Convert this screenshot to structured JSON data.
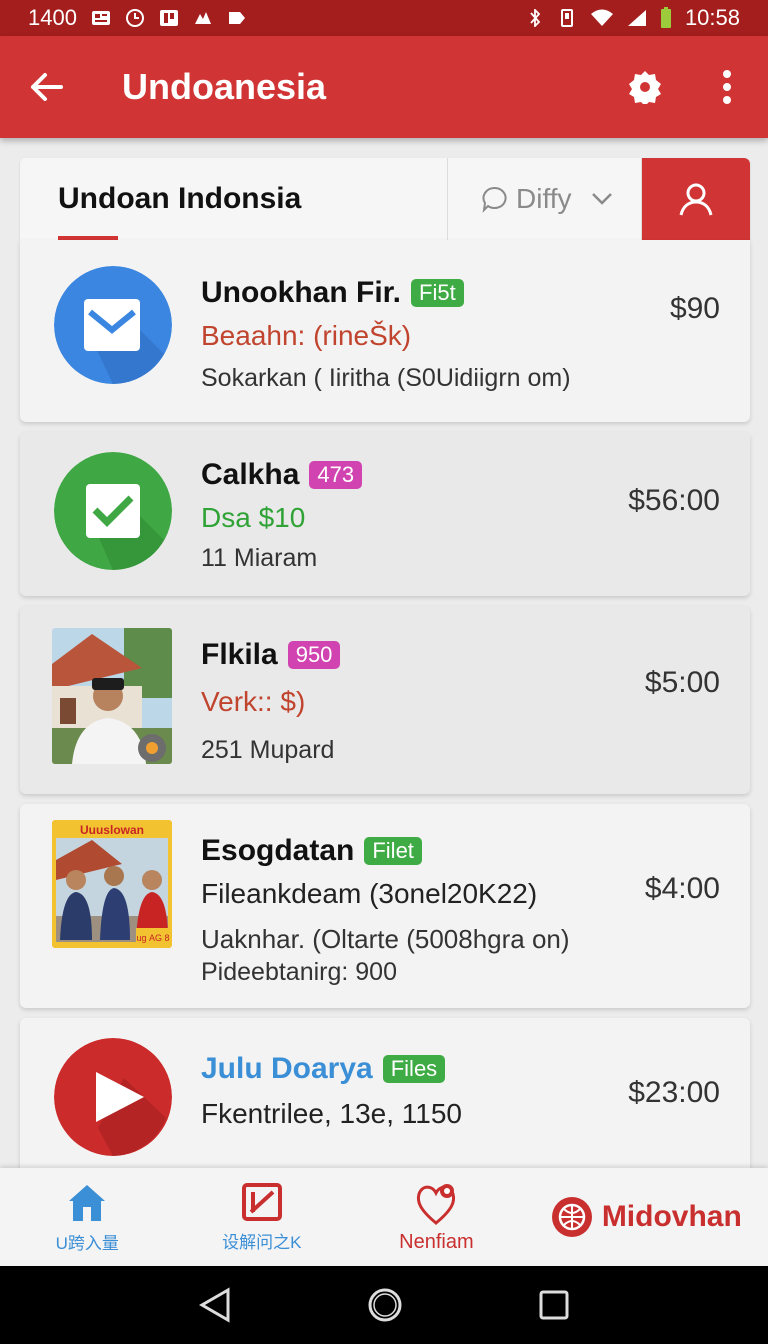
{
  "status_bar": {
    "left_text": "1400",
    "time": "10:58"
  },
  "app_bar": {
    "title": "Undoanesia"
  },
  "tabs": {
    "main": "Undoan Indonsia",
    "filter": "Diffy"
  },
  "items": [
    {
      "name": "Unookhan Fir.",
      "badge": "Fi5t",
      "sub": "Beaahn: (rineŠk)",
      "meta": "Sokarkan ( Iiritha (S0Uidiigrn om)",
      "price": "$90"
    },
    {
      "name": "Calkha",
      "badge": "473",
      "sub": "Dsa $10",
      "meta": "11 Miaram",
      "price": "$56:00"
    },
    {
      "name": "Flkila",
      "badge": "950",
      "sub": "Verk:: $)",
      "meta": "251 Mupard",
      "price": "$5:00"
    },
    {
      "name": "Esogdatan",
      "badge": "Filet",
      "sub": "Fileankdeam (3onel20K22)",
      "meta": "Uaknhar. (Oltarte (5008hgra on)",
      "meta2": "Pideebtanirg: 900",
      "price": "$4:00",
      "poster_text": "Uuuslowan",
      "poster_corner": "ug\nАG 8"
    },
    {
      "name": "Julu Doarya",
      "badge": "Files",
      "sub": "Fkentrilee, 13e, 1150",
      "price": "$23:00"
    }
  ],
  "bottom_nav": {
    "home": "U跨入量",
    "second": "设解问之Κ",
    "third": "Nenfiam",
    "brand": "Midovhan"
  },
  "colors": {
    "primary": "#d13434",
    "status": "#a41e1e",
    "green": "#3eab44",
    "pink": "#d043b0",
    "blue_text": "#3b8fd6"
  }
}
